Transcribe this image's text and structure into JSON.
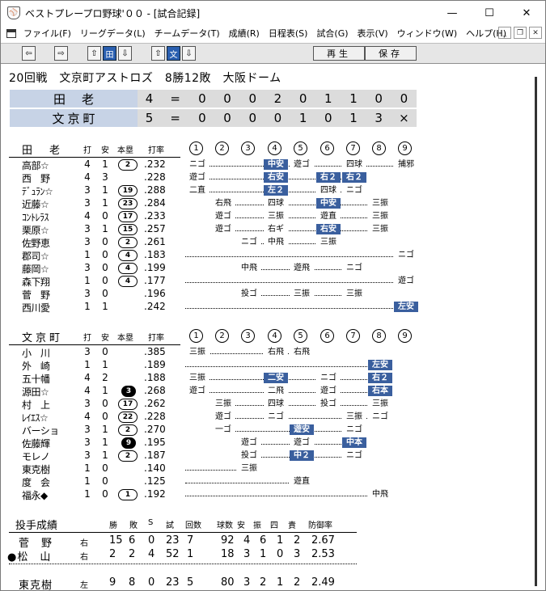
{
  "window": {
    "title": "ベストプレープロ野球'００ - [試合記録]",
    "buttons": {
      "minimize": "—",
      "maximize": "☐",
      "close": "✕"
    }
  },
  "menu": [
    "ファイル(F)",
    "リーグデータ(L)",
    "チームデータ(T)",
    "成績(R)",
    "日程表(S)",
    "試合(G)",
    "表示(V)",
    "ウィンドウ(W)",
    "ヘルプ(H)"
  ],
  "toolbar": {
    "left_arrow": "⇦",
    "right_arrow": "⇨",
    "up_arrow": "⇧",
    "down_arrow": "⇩",
    "team1_btn": "田",
    "team2_btn": "文",
    "play_label": "再生",
    "save_label": "保存"
  },
  "game": {
    "title": "20回戦　文京町アストロズ　8勝12敗　大阪ドーム",
    "teams": [
      {
        "name": "田老",
        "total": "4",
        "eq": "=",
        "innings": [
          "0",
          "0",
          "0",
          "2",
          "0",
          "1",
          "1",
          "0",
          "0"
        ]
      },
      {
        "name": "文京町",
        "total": "5",
        "eq": "=",
        "innings": [
          "0",
          "0",
          "0",
          "0",
          "1",
          "0",
          "1",
          "3",
          "×"
        ]
      }
    ]
  },
  "headers": {
    "ab": "打",
    "h": "安",
    "hr": "本塁",
    "avg": "打率",
    "innings": [
      "1",
      "2",
      "3",
      "4",
      "5",
      "6",
      "7",
      "8",
      "9"
    ]
  },
  "batting": [
    {
      "team": "田　老",
      "players": [
        {
          "name": "高部☆",
          "ab": "4",
          "h": "1",
          "hr": "2",
          "hr_fill": false,
          "avg": ".232",
          "res": [
            "ニゴ",
            "",
            "",
            "中安",
            "遊ゴ",
            "",
            "四球",
            "",
            "捕邪"
          ],
          "hits": [
            false,
            false,
            false,
            true,
            false,
            false,
            false,
            false,
            false
          ]
        },
        {
          "name": "西　野",
          "ab": "4",
          "h": "3",
          "hr": "",
          "hr_fill": false,
          "avg": ".228",
          "res": [
            "遊ゴ",
            "",
            "",
            "右安",
            "",
            "右２",
            "右２",
            "",
            ""
          ],
          "hits": [
            false,
            false,
            false,
            true,
            false,
            true,
            true,
            false,
            false
          ]
        },
        {
          "name": "ﾃﾞｭﾗﾝ☆",
          "ab": "3",
          "h": "1",
          "hr": "19",
          "hr_fill": false,
          "avg": ".288",
          "res": [
            "二直",
            "",
            "",
            "左２",
            "",
            "四球",
            "ニゴ",
            "",
            ""
          ],
          "hits": [
            false,
            false,
            false,
            true,
            false,
            false,
            false,
            false,
            false
          ]
        },
        {
          "name": "近藤☆",
          "ab": "3",
          "h": "1",
          "hr": "23",
          "hr_fill": false,
          "avg": ".284",
          "res": [
            "",
            "右飛",
            "",
            "四球",
            "",
            "中安",
            "",
            "三振",
            ""
          ],
          "hits": [
            false,
            false,
            false,
            false,
            false,
            true,
            false,
            false,
            false
          ]
        },
        {
          "name": "ｺﾝﾄﾚﾗｽ",
          "ab": "4",
          "h": "0",
          "hr": "17",
          "hr_fill": false,
          "avg": ".233",
          "res": [
            "",
            "遊ゴ",
            "",
            "三振",
            "",
            "遊直",
            "",
            "三振",
            ""
          ],
          "hits": [
            false,
            false,
            false,
            false,
            false,
            false,
            false,
            false,
            false
          ]
        },
        {
          "name": "栗原☆",
          "ab": "3",
          "h": "1",
          "hr": "15",
          "hr_fill": false,
          "avg": ".257",
          "res": [
            "",
            "遊ゴ",
            "",
            "右ギ",
            "",
            "右安",
            "",
            "三振",
            ""
          ],
          "hits": [
            false,
            false,
            false,
            false,
            false,
            true,
            false,
            false,
            false
          ]
        },
        {
          "name": "佐野恵",
          "ab": "3",
          "h": "0",
          "hr": "2",
          "hr_fill": false,
          "avg": ".261",
          "res": [
            "",
            "",
            "ニゴ",
            "中飛",
            "",
            "三振",
            "",
            "",
            ""
          ],
          "hits": [
            false,
            false,
            false,
            false,
            false,
            false,
            false,
            false,
            false
          ]
        },
        {
          "name": "郡司☆",
          "ab": "1",
          "h": "0",
          "hr": "4",
          "hr_fill": false,
          "avg": ".183",
          "res": [
            "",
            "",
            "",
            "",
            "",
            "",
            "",
            "",
            "ニゴ"
          ],
          "hits": [
            false,
            false,
            false,
            false,
            false,
            false,
            false,
            false,
            false
          ]
        },
        {
          "name": "藤岡☆",
          "ab": "3",
          "h": "0",
          "hr": "4",
          "hr_fill": false,
          "avg": ".199",
          "res": [
            "",
            "",
            "中飛",
            "",
            "遊飛",
            "",
            "ニゴ",
            "",
            ""
          ],
          "hits": [
            false,
            false,
            false,
            false,
            false,
            false,
            false,
            false,
            false
          ]
        },
        {
          "name": "森下翔",
          "ab": "1",
          "h": "0",
          "hr": "4",
          "hr_fill": false,
          "avg": ".177",
          "res": [
            "",
            "",
            "",
            "",
            "",
            "",
            "",
            "",
            "遊ゴ"
          ],
          "hits": [
            false,
            false,
            false,
            false,
            false,
            false,
            false,
            false,
            false
          ]
        },
        {
          "name": "菅　野",
          "ab": "3",
          "h": "0",
          "hr": "",
          "hr_fill": false,
          "avg": ".196",
          "res": [
            "",
            "",
            "投ゴ",
            "",
            "三振",
            "",
            "三振",
            "",
            ""
          ],
          "hits": [
            false,
            false,
            false,
            false,
            false,
            false,
            false,
            false,
            false
          ]
        },
        {
          "name": "西川愛",
          "ab": "1",
          "h": "1",
          "hr": "",
          "hr_fill": false,
          "avg": ".242",
          "res": [
            "",
            "",
            "",
            "",
            "",
            "",
            "",
            "",
            "左安"
          ],
          "hits": [
            false,
            false,
            false,
            false,
            false,
            false,
            false,
            false,
            true
          ]
        }
      ]
    },
    {
      "team": "文京町",
      "players": [
        {
          "name": "小　川",
          "ab": "3",
          "h": "0",
          "hr": "",
          "hr_fill": false,
          "avg": ".385",
          "res": [
            "三振",
            "",
            "",
            "右飛",
            "右飛",
            "",
            "",
            "",
            ""
          ],
          "hits": [
            false,
            false,
            false,
            false,
            false,
            false,
            false,
            false,
            false
          ]
        },
        {
          "name": "外　崎",
          "ab": "1",
          "h": "1",
          "hr": "",
          "hr_fill": false,
          "avg": ".189",
          "res": [
            "",
            "",
            "",
            "",
            "",
            "",
            "",
            "左安",
            ""
          ],
          "hits": [
            false,
            false,
            false,
            false,
            false,
            false,
            false,
            true,
            false
          ]
        },
        {
          "name": "五十幡",
          "ab": "4",
          "h": "2",
          "hr": "",
          "hr_fill": false,
          "avg": ".188",
          "res": [
            "三振",
            "",
            "",
            "二安",
            "",
            "ニゴ",
            "",
            "右２",
            ""
          ],
          "hits": [
            false,
            false,
            false,
            true,
            false,
            false,
            false,
            true,
            false
          ]
        },
        {
          "name": "源田☆",
          "ab": "4",
          "h": "1",
          "hr": "3",
          "hr_fill": true,
          "avg": ".268",
          "res": [
            "遊ゴ",
            "",
            "",
            "二飛",
            "",
            "遊ゴ",
            "",
            "右本",
            ""
          ],
          "hits": [
            false,
            false,
            false,
            false,
            false,
            false,
            false,
            true,
            false
          ]
        },
        {
          "name": "村　上",
          "ab": "3",
          "h": "0",
          "hr": "17",
          "hr_fill": false,
          "avg": ".262",
          "res": [
            "",
            "三振",
            "",
            "四球",
            "",
            "投ゴ",
            "",
            "三振",
            ""
          ],
          "hits": [
            false,
            false,
            false,
            false,
            false,
            false,
            false,
            false,
            false
          ]
        },
        {
          "name": "ﾚｲｴｽ☆",
          "ab": "4",
          "h": "0",
          "hr": "22",
          "hr_fill": false,
          "avg": ".228",
          "res": [
            "",
            "遊ゴ",
            "",
            "ニゴ",
            "",
            "",
            "三振",
            "ニゴ",
            ""
          ],
          "hits": [
            false,
            false,
            false,
            false,
            false,
            false,
            false,
            false,
            false
          ]
        },
        {
          "name": "バーショ",
          "ab": "3",
          "h": "1",
          "hr": "2",
          "hr_fill": false,
          "avg": ".270",
          "res": [
            "",
            "一ゴ",
            "",
            "",
            "遊安",
            "",
            "ニゴ",
            "",
            ""
          ],
          "hits": [
            false,
            false,
            false,
            false,
            true,
            false,
            false,
            false,
            false
          ]
        },
        {
          "name": "佐藤輝",
          "ab": "3",
          "h": "1",
          "hr": "9",
          "hr_fill": true,
          "avg": ".195",
          "res": [
            "",
            "",
            "遊ゴ",
            "",
            "遊ゴ",
            "",
            "中本",
            "",
            ""
          ],
          "hits": [
            false,
            false,
            false,
            false,
            false,
            false,
            true,
            false,
            false
          ]
        },
        {
          "name": "モレノ",
          "ab": "3",
          "h": "1",
          "hr": "2",
          "hr_fill": false,
          "avg": ".187",
          "res": [
            "",
            "",
            "投ゴ",
            "",
            "中２",
            "",
            "ニゴ",
            "",
            ""
          ],
          "hits": [
            false,
            false,
            false,
            false,
            true,
            false,
            false,
            false,
            false
          ]
        },
        {
          "name": "東克樹",
          "ab": "1",
          "h": "0",
          "hr": "",
          "hr_fill": false,
          "avg": ".140",
          "res": [
            "",
            "",
            "三振",
            "",
            "",
            "",
            "",
            "",
            ""
          ],
          "hits": [
            false,
            false,
            false,
            false,
            false,
            false,
            false,
            false,
            false
          ]
        },
        {
          "name": "度　会",
          "ab": "1",
          "h": "0",
          "hr": "",
          "hr_fill": false,
          "avg": ".125",
          "res": [
            "",
            "",
            "",
            "",
            "遊直",
            "",
            "",
            "",
            ""
          ],
          "hits": [
            false,
            false,
            false,
            false,
            false,
            false,
            false,
            false,
            false
          ]
        },
        {
          "name": "福永◆",
          "ab": "1",
          "h": "0",
          "hr": "1",
          "hr_fill": false,
          "avg": ".192",
          "res": [
            "",
            "",
            "",
            "",
            "",
            "",
            "",
            "中飛",
            ""
          ],
          "hits": [
            false,
            false,
            false,
            false,
            false,
            false,
            false,
            false,
            false
          ]
        }
      ]
    }
  ],
  "pitching": {
    "title": "投手成績",
    "headers": [
      "勝",
      "敗",
      "S",
      "試",
      "回数",
      "球数",
      "安",
      "振",
      "四",
      "責",
      "防御率"
    ],
    "rows": [
      {
        "name": "　菅　野",
        "hand": "右",
        "w": "15",
        "l": "6",
        "s": "0",
        "g": "23",
        "ip": "7",
        "np": "92",
        "h": "4",
        "k": "6",
        "bb": "1",
        "er": "2",
        "era": "2.67"
      },
      {
        "name": "●松　山",
        "hand": "右",
        "w": "2",
        "l": "2",
        "s": "4",
        "g": "52",
        "ip": "1",
        "np": "18",
        "h": "3",
        "k": "1",
        "bb": "0",
        "er": "3",
        "era": "2.53"
      },
      {
        "name": "　東克樹",
        "hand": "左",
        "w": "9",
        "l": "8",
        "s": "0",
        "g": "23",
        "ip": "5",
        "np": "80",
        "h": "3",
        "k": "2",
        "bb": "1",
        "er": "2",
        "era": "2.49"
      }
    ]
  }
}
